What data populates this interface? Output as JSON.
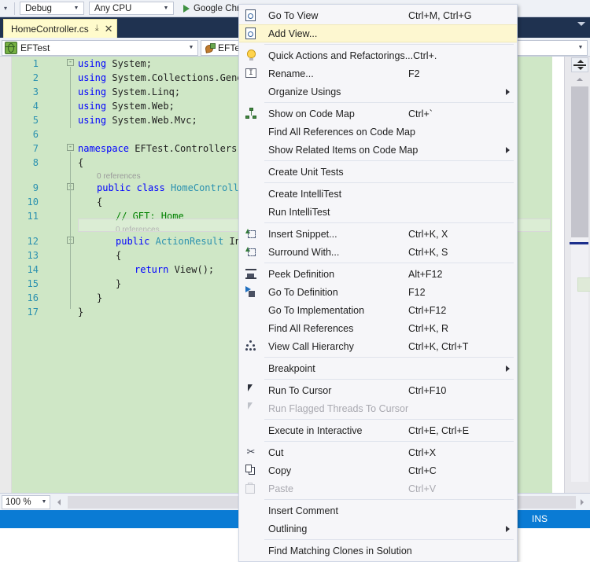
{
  "toolbar": {
    "config_combo": "Debug",
    "platform_combo": "Any CPU",
    "run_label": "Google Chrom",
    "run_icon": "play-triangle-icon"
  },
  "tabstrip": {
    "active_tab": "HomeController.cs",
    "pin_glyph": "⤓",
    "close_glyph": "✕",
    "overflow_glyph": "chevron-down-icon"
  },
  "navbar": {
    "type_combo": "EFTest",
    "member_combo": "EFTes",
    "type_icon": "namespace-globe-icon",
    "member_icon": "method-icon"
  },
  "editor": {
    "zoom": "100 %",
    "lines": [
      {
        "num": "1",
        "fold": "-",
        "indent": 0,
        "html": "<span class='k'>using</span> System;"
      },
      {
        "num": "2",
        "fold": "",
        "indent": 0,
        "html": "<span class='k'>using</span> System.Collections.Gener"
      },
      {
        "num": "3",
        "fold": "",
        "indent": 0,
        "html": "<span class='k'>using</span> System.Linq;"
      },
      {
        "num": "4",
        "fold": "",
        "indent": 0,
        "html": "<span class='k'>using</span> System.Web;"
      },
      {
        "num": "5",
        "fold": "",
        "indent": 0,
        "html": "<span class='k'>using</span> System.Web.Mvc;"
      },
      {
        "num": "6",
        "fold": "",
        "indent": 0,
        "html": ""
      },
      {
        "num": "7",
        "fold": "-",
        "indent": 0,
        "html": "<span class='k'>namespace</span> EFTest.Controllers"
      },
      {
        "num": "8",
        "fold": "",
        "indent": 0,
        "html": "{"
      },
      {
        "num": "9",
        "fold": "-",
        "indent": 1,
        "html": "<span class='k'>public</span> <span class='k'>class</span> <span class='t'>HomeControlle</span>"
      },
      {
        "num": "10",
        "fold": "",
        "indent": 1,
        "html": "{"
      },
      {
        "num": "11",
        "fold": "",
        "indent": 2,
        "html": "<span class='c'>// GET: Home</span>"
      },
      {
        "num": "12",
        "fold": "-",
        "indent": 2,
        "html": "<span class='k'>public</span> <span class='t'>ActionResult</span> In"
      },
      {
        "num": "13",
        "fold": "",
        "indent": 2,
        "html": "{"
      },
      {
        "num": "14",
        "fold": "",
        "indent": 3,
        "html": "<span class='k'>return</span> View();"
      },
      {
        "num": "15",
        "fold": "",
        "indent": 2,
        "html": "}"
      },
      {
        "num": "16",
        "fold": "",
        "indent": 1,
        "html": "}"
      },
      {
        "num": "17",
        "fold": "",
        "indent": 0,
        "html": "}"
      }
    ],
    "codelens": [
      {
        "line_index": 8,
        "text": "0 references"
      },
      {
        "line_index": 11,
        "text": "0 references"
      }
    ]
  },
  "statusbar": {
    "insert_mode": "INS"
  },
  "context_menu": {
    "items": [
      {
        "label": "Go To View",
        "shortcut": "Ctrl+M, Ctrl+G",
        "icon": "view-page-icon",
        "highlighted": false,
        "disabled": false,
        "submenu": false
      },
      {
        "label": "Add View...",
        "shortcut": "",
        "icon": "add-view-page-icon",
        "highlighted": true,
        "disabled": false,
        "submenu": false
      },
      {
        "separator": true
      },
      {
        "label": "Quick Actions and Refactorings...",
        "shortcut": "Ctrl+.",
        "icon": "lightbulb-icon",
        "highlighted": false,
        "disabled": false,
        "submenu": false
      },
      {
        "label": "Rename...",
        "shortcut": "F2",
        "icon": "rename-icon",
        "highlighted": false,
        "disabled": false,
        "submenu": false
      },
      {
        "label": "Organize Usings",
        "shortcut": "",
        "icon": "",
        "highlighted": false,
        "disabled": false,
        "submenu": true
      },
      {
        "separator": true
      },
      {
        "label": "Show on Code Map",
        "shortcut": "Ctrl+`",
        "icon": "code-map-icon",
        "highlighted": false,
        "disabled": false,
        "submenu": false
      },
      {
        "label": "Find All References on Code Map",
        "shortcut": "",
        "icon": "",
        "highlighted": false,
        "disabled": false,
        "submenu": false
      },
      {
        "label": "Show Related Items on Code Map",
        "shortcut": "",
        "icon": "",
        "highlighted": false,
        "disabled": false,
        "submenu": true
      },
      {
        "separator": true
      },
      {
        "label": "Create Unit Tests",
        "shortcut": "",
        "icon": "",
        "highlighted": false,
        "disabled": false,
        "submenu": false
      },
      {
        "separator": true
      },
      {
        "label": "Create IntelliTest",
        "shortcut": "",
        "icon": "",
        "highlighted": false,
        "disabled": false,
        "submenu": false
      },
      {
        "label": "Run IntelliTest",
        "shortcut": "",
        "icon": "",
        "highlighted": false,
        "disabled": false,
        "submenu": false
      },
      {
        "separator": true
      },
      {
        "label": "Insert Snippet...",
        "shortcut": "Ctrl+K, X",
        "icon": "insert-snippet-icon",
        "highlighted": false,
        "disabled": false,
        "submenu": false
      },
      {
        "label": "Surround With...",
        "shortcut": "Ctrl+K, S",
        "icon": "surround-with-icon",
        "highlighted": false,
        "disabled": false,
        "submenu": false
      },
      {
        "separator": true
      },
      {
        "label": "Peek Definition",
        "shortcut": "Alt+F12",
        "icon": "peek-definition-icon",
        "highlighted": false,
        "disabled": false,
        "submenu": false
      },
      {
        "label": "Go To Definition",
        "shortcut": "F12",
        "icon": "go-to-definition-icon",
        "highlighted": false,
        "disabled": false,
        "submenu": false
      },
      {
        "label": "Go To Implementation",
        "shortcut": "Ctrl+F12",
        "icon": "",
        "highlighted": false,
        "disabled": false,
        "submenu": false
      },
      {
        "label": "Find All References",
        "shortcut": "Ctrl+K, R",
        "icon": "",
        "highlighted": false,
        "disabled": false,
        "submenu": false
      },
      {
        "label": "View Call Hierarchy",
        "shortcut": "Ctrl+K, Ctrl+T",
        "icon": "call-hierarchy-icon",
        "highlighted": false,
        "disabled": false,
        "submenu": false
      },
      {
        "separator": true
      },
      {
        "label": "Breakpoint",
        "shortcut": "",
        "icon": "",
        "highlighted": false,
        "disabled": false,
        "submenu": true
      },
      {
        "separator": true
      },
      {
        "label": "Run To Cursor",
        "shortcut": "Ctrl+F10",
        "icon": "cursor-arrow-icon",
        "highlighted": false,
        "disabled": false,
        "submenu": false
      },
      {
        "label": "Run Flagged Threads To Cursor",
        "shortcut": "",
        "icon": "cursor-arrow-disabled-icon",
        "highlighted": false,
        "disabled": true,
        "submenu": false
      },
      {
        "separator": true
      },
      {
        "label": "Execute in Interactive",
        "shortcut": "Ctrl+E, Ctrl+E",
        "icon": "",
        "highlighted": false,
        "disabled": false,
        "submenu": false
      },
      {
        "separator": true
      },
      {
        "label": "Cut",
        "shortcut": "Ctrl+X",
        "icon": "cut-scissors-icon",
        "highlighted": false,
        "disabled": false,
        "submenu": false
      },
      {
        "label": "Copy",
        "shortcut": "Ctrl+C",
        "icon": "copy-icon",
        "highlighted": false,
        "disabled": false,
        "submenu": false
      },
      {
        "label": "Paste",
        "shortcut": "Ctrl+V",
        "icon": "paste-icon",
        "highlighted": false,
        "disabled": true,
        "submenu": false
      },
      {
        "separator": true
      },
      {
        "label": "Insert Comment",
        "shortcut": "",
        "icon": "",
        "highlighted": false,
        "disabled": false,
        "submenu": false
      },
      {
        "label": "Outlining",
        "shortcut": "",
        "icon": "",
        "highlighted": false,
        "disabled": false,
        "submenu": true
      },
      {
        "separator": true
      },
      {
        "label": "Find Matching Clones in Solution",
        "shortcut": "",
        "icon": "",
        "highlighted": false,
        "disabled": false,
        "submenu": false
      }
    ]
  },
  "colors": {
    "menu_background": "#f6f6f9",
    "menu_highlight": "#fdf7d0",
    "editor_background": "#cfe7c6",
    "keyword": "#0000ff",
    "type": "#2b91af",
    "comment": "#008000",
    "line_number": "#2b91af",
    "statusbar": "#0a7bd4",
    "tab_active": "#fffbcc",
    "tabstrip": "#1f3250"
  }
}
